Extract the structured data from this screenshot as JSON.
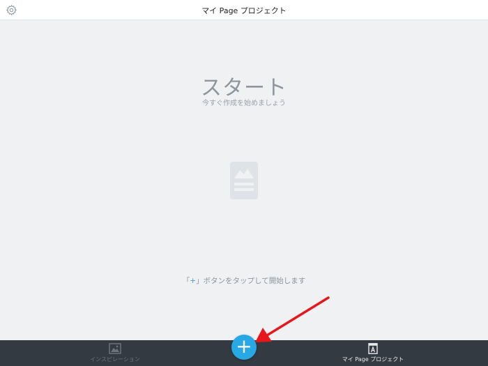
{
  "header": {
    "title": "マイ Page プロジェクト",
    "settings_icon": "gear-icon"
  },
  "empty_state": {
    "title": "スタート",
    "subtitle": "今すぐ作成を始めましょう",
    "placeholder_icon": "image-document-icon",
    "hint_prefix": "「",
    "hint_plus": "+",
    "hint_suffix": "」ボタンをタップして開始します"
  },
  "tabbar": {
    "tabs": [
      {
        "label": "インスピレーション",
        "icon": "gallery-icon",
        "active": false
      },
      {
        "label": "マイ Page プロジェクト",
        "icon": "page-document-icon",
        "active": true
      }
    ],
    "fab_label": "+",
    "fab_icon": "plus-icon"
  },
  "annotation": {
    "arrow_color": "#e8161a",
    "arrow_icon": "red-arrow-icon"
  },
  "colors": {
    "accent": "#29a8e6",
    "tabbar_bg": "#333a42",
    "background": "#f0f1f3"
  }
}
